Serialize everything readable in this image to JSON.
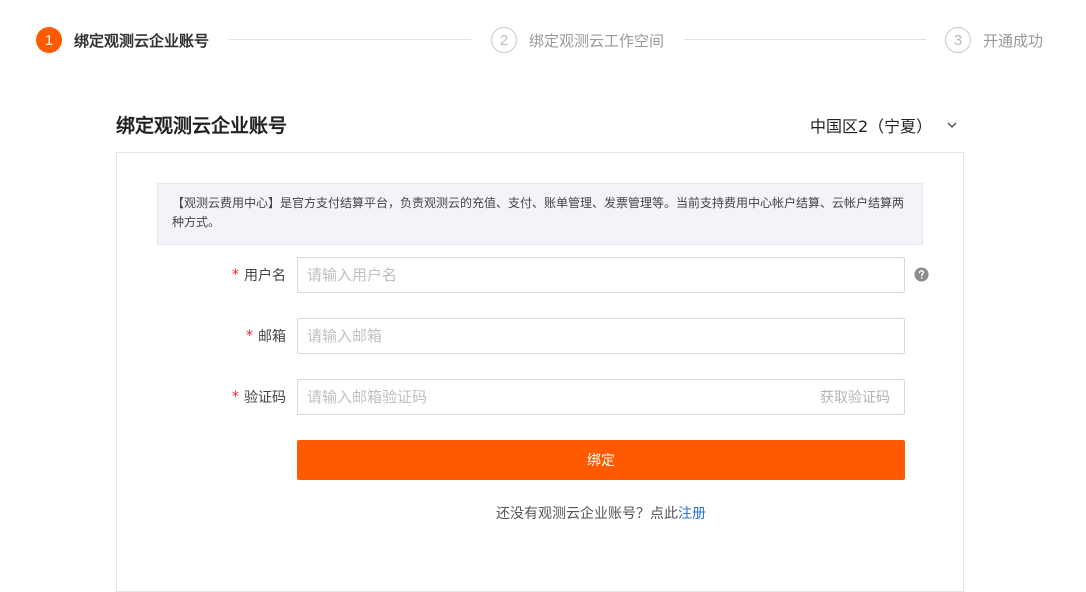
{
  "steps": [
    {
      "number": "1",
      "label": "绑定观测云企业账号",
      "state": "active"
    },
    {
      "number": "2",
      "label": "绑定观测云工作空间",
      "state": "pending"
    },
    {
      "number": "3",
      "label": "开通成功",
      "state": "pending"
    }
  ],
  "page": {
    "title": "绑定观测云企业账号",
    "region": {
      "selected": "中国区2（宁夏）",
      "icon": "chevron-down-icon"
    }
  },
  "notice": {
    "text": "【观测云费用中心】是官方支付结算平台，负责观测云的充值、支付、账单管理、发票管理等。当前支持费用中心帐户结算、云帐户结算两种方式。"
  },
  "form": {
    "required_mark": "*",
    "username": {
      "label": "用户名",
      "placeholder": "请输入用户名",
      "value": "",
      "help_icon": "question-circle-icon"
    },
    "email": {
      "label": "邮箱",
      "placeholder": "请输入邮箱",
      "value": ""
    },
    "code": {
      "label": "验证码",
      "placeholder": "请输入邮箱验证码",
      "value": "",
      "action": "获取验证码"
    },
    "submit": "绑定"
  },
  "footer": {
    "prompt": "还没有观测云企业账号？点此",
    "link": "注册"
  },
  "colors": {
    "accent": "#ff5a00",
    "link": "#2f6fde",
    "required": "#f5222d",
    "notice_bg": "#f3f4f9"
  }
}
